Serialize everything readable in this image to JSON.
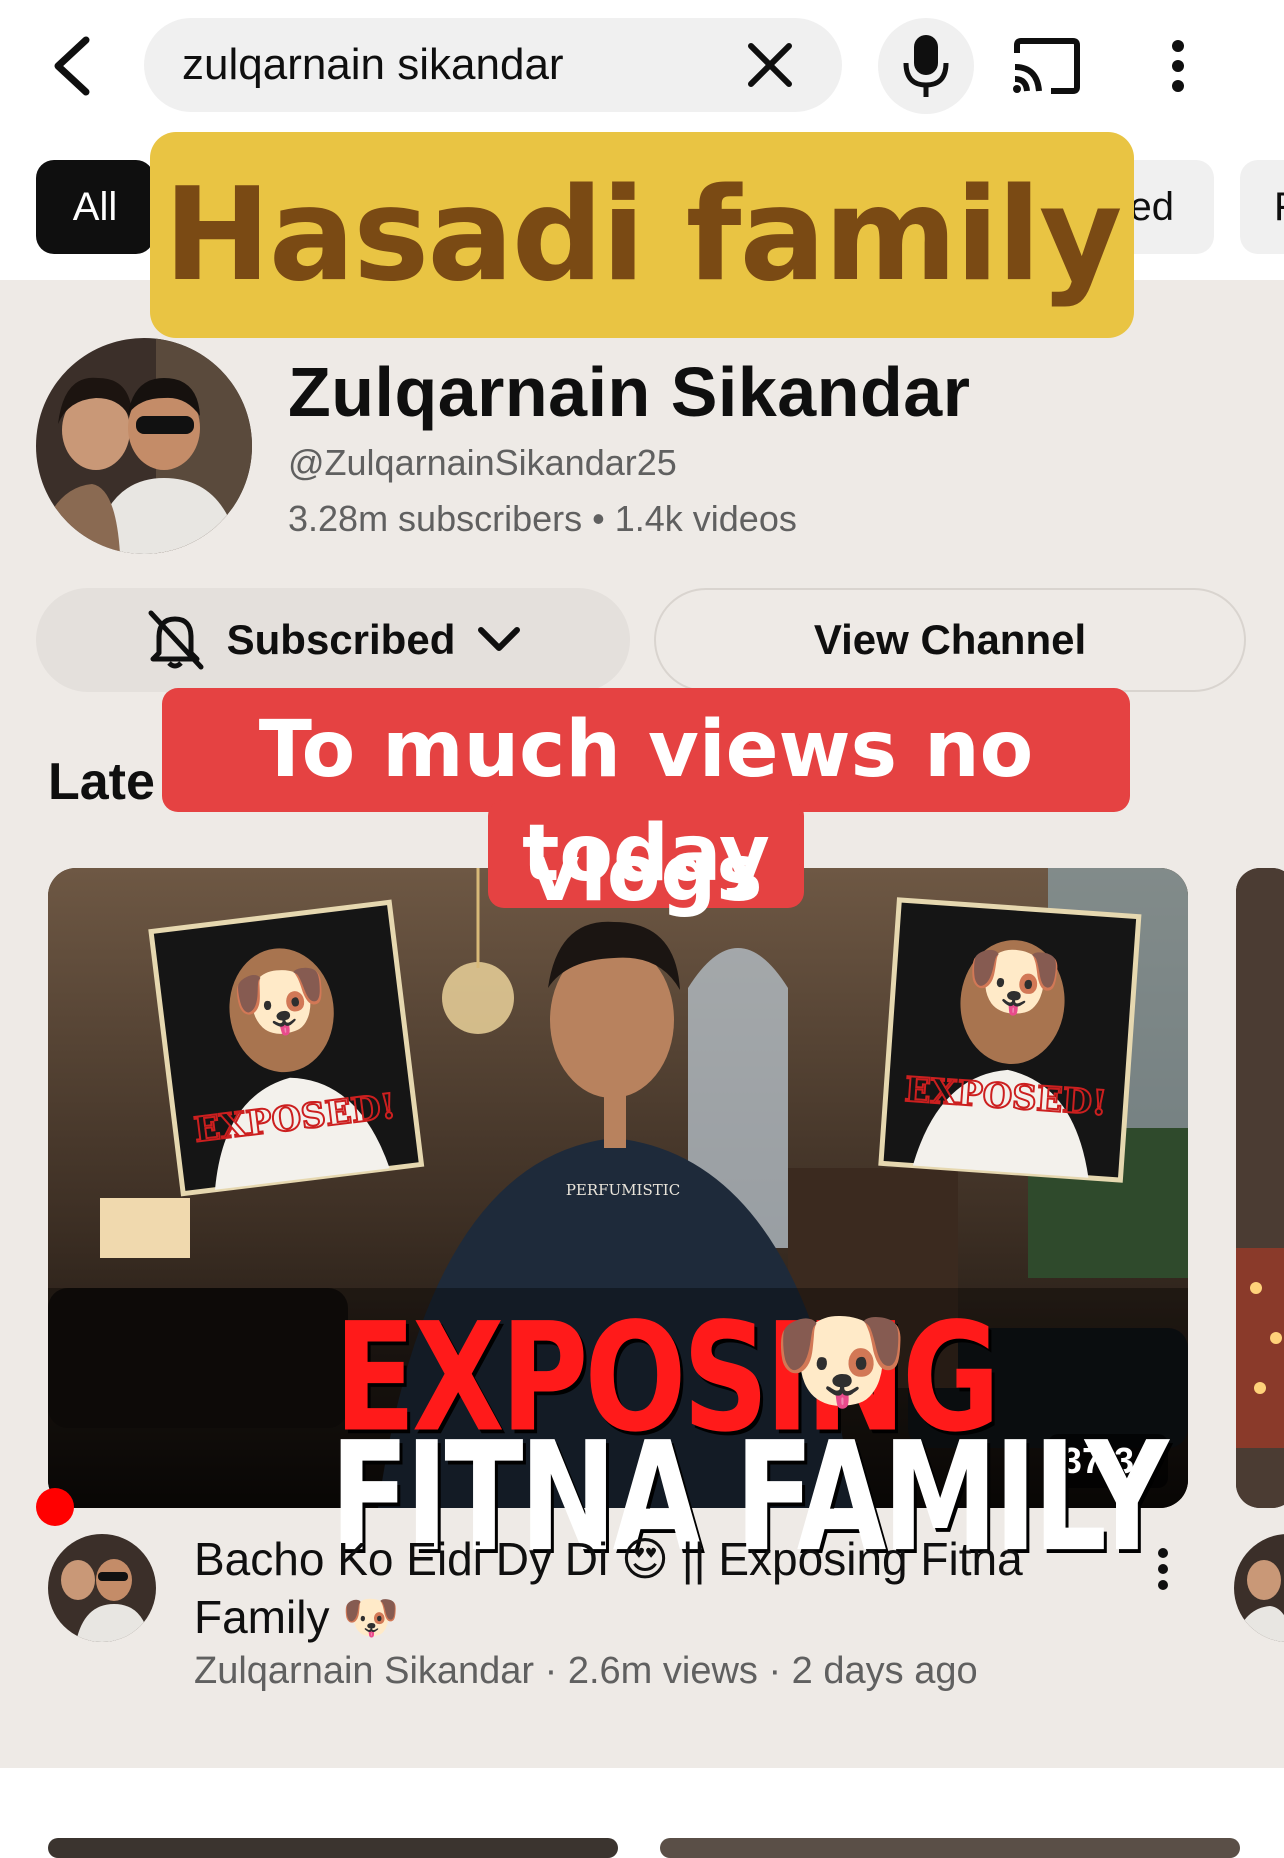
{
  "search": {
    "query": "zulqarnain sikandar"
  },
  "chips": {
    "items": [
      {
        "label": "All"
      },
      {
        "label": "ed"
      },
      {
        "label": "F"
      }
    ]
  },
  "overlays": {
    "top_caption": "Hasadi family",
    "middle_caption_line1": "To much views no vlogs",
    "middle_caption_line2": "today"
  },
  "channel": {
    "name": "Zulqarnain Sikandar",
    "handle": "@ZulqarnainSikandar25",
    "stats": "3.28m subscribers • 1.4k videos",
    "subscribed_label": "Subscribed",
    "view_channel_label": "View Channel"
  },
  "section": {
    "title": "Late"
  },
  "video": {
    "thumbnail_line1": "EXPOSING",
    "thumbnail_line2": "FITNA FAMILY",
    "shirt_text": "PERFUMISTIC",
    "stamp_text": "EXPOSED!",
    "duration": "37:34",
    "title": "Bacho Ko Eidi Dy Di 😍 || Exposing Fitna Family 🐶",
    "meta": "Zulqarnain Sikandar · 2.6m views · 2 days ago",
    "emoji": "🐶"
  },
  "colors": {
    "accent_red": "#ff0000",
    "caption_yellow": "#e9c443",
    "caption_red": "#e54242",
    "page_background": "#eeeae6"
  }
}
